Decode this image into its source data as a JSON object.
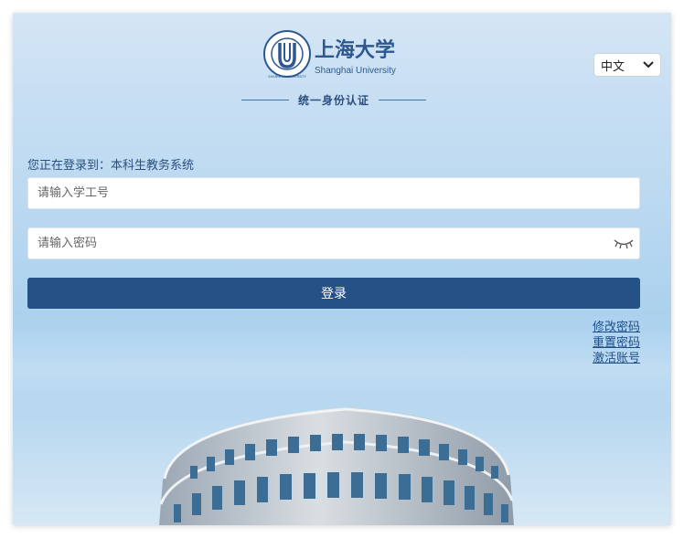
{
  "header": {
    "logo_cn": "上海大学",
    "logo_en": "Shanghai University",
    "seal_text": "SHANGHAI UNIVERSITY",
    "subtitle": "统一身份认证"
  },
  "language": {
    "selected": "中文"
  },
  "login": {
    "target_hint": "您正在登录到：本科生教务系统",
    "username_placeholder": "请输入学工号",
    "password_placeholder": "请输入密码",
    "submit_label": "登录"
  },
  "links": {
    "change_password": "修改密码",
    "reset_password": "重置密码",
    "activate_account": "激活账号"
  },
  "icons": {
    "password_toggle": "eye-closed-icon",
    "dropdown": "chevron-down-icon",
    "seal": "university-seal-icon"
  },
  "colors": {
    "brand": "#265186",
    "link": "#1f4f88",
    "text": "#2b4f7e"
  }
}
